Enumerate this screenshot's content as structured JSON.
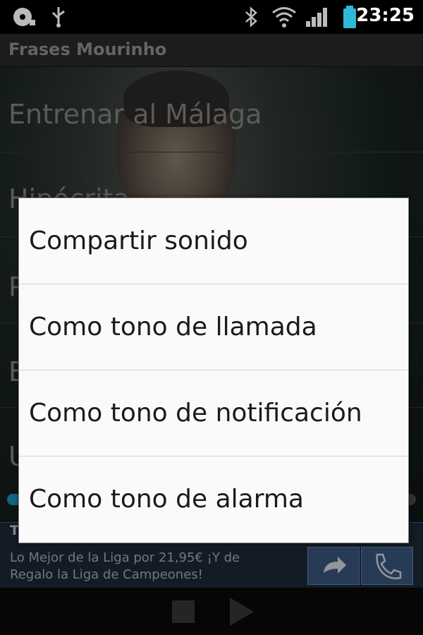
{
  "status_bar": {
    "time": "23:25",
    "icons": [
      "sd-card-icon",
      "usb-icon",
      "bluetooth-icon",
      "wifi-icon",
      "signal-icon",
      "battery-icon"
    ]
  },
  "app": {
    "title": "Frases Mourinho"
  },
  "list": {
    "items": [
      {
        "label": "Entrenar al Málaga"
      },
      {
        "label": "Hipócrita"
      },
      {
        "label": "P"
      },
      {
        "label": "B"
      },
      {
        "label": "U"
      }
    ]
  },
  "playback": {
    "progress": 0.05
  },
  "ad": {
    "title": "T",
    "text": "Lo Mejor de la Liga por 21,95€ ¡Y de Regalo la Liga de Campeones!"
  },
  "dialog": {
    "options": [
      {
        "label": "Compartir sonido"
      },
      {
        "label": "Como tono de llamada"
      },
      {
        "label": "Como tono de notificación"
      },
      {
        "label": "Como tono de alarma"
      }
    ]
  },
  "colors": {
    "accent": "#1a9dbf",
    "ad_background": "#1c2a3b",
    "dialog_background": "#fafafa"
  }
}
